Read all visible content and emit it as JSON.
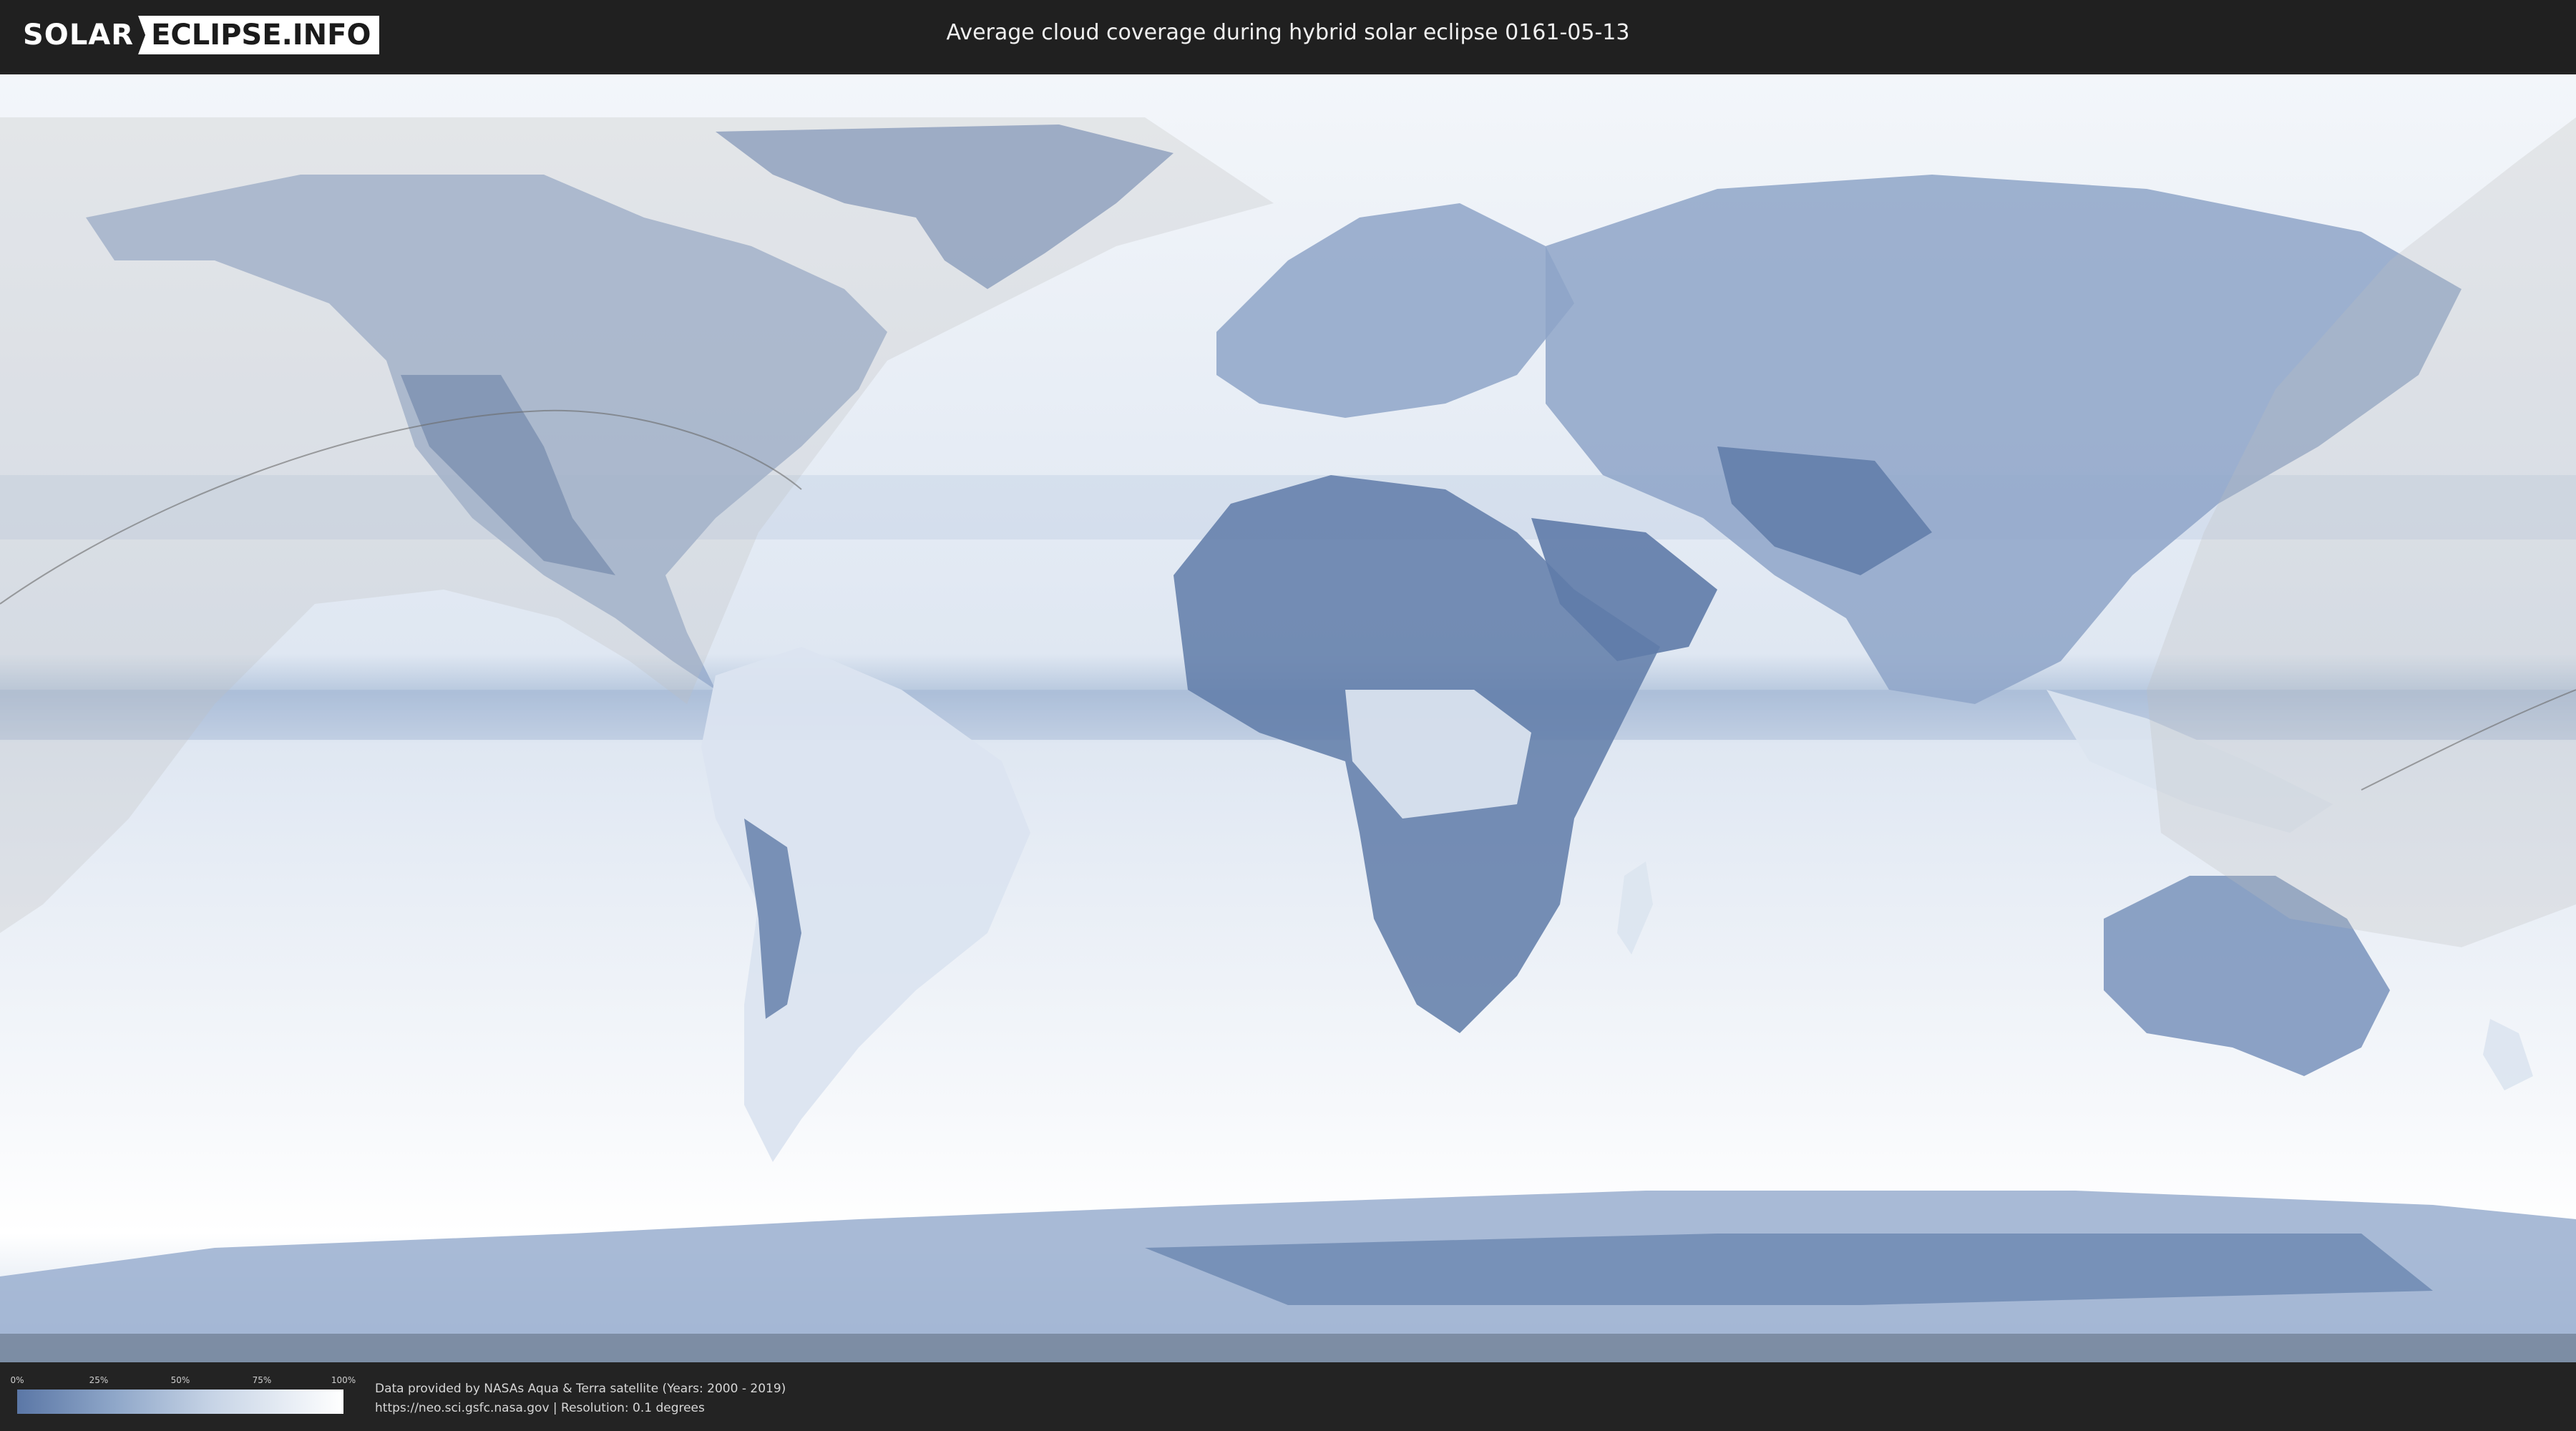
{
  "header": {
    "logo_left": "SOLAR",
    "logo_right": "ECLIPSE.INFO",
    "title": "Average cloud coverage during hybrid solar eclipse 0161-05-13"
  },
  "map": {
    "ocean_color": "#e6edf6",
    "land_cloudfree_color": "#5f7ba8",
    "shadow_color": "#bfbfbf"
  },
  "legend": {
    "ticks": [
      "0%",
      "25%",
      "50%",
      "75%",
      "100%"
    ],
    "gradient_start": "#5b77a6",
    "gradient_end": "#ffffff"
  },
  "footer": {
    "credit_line1": "Data provided by NASAs Aqua & Terra satellite (Years: 2000 - 2019)",
    "credit_line2": "https://neo.sci.gsfc.nasa.gov | Resolution: 0.1 degrees"
  }
}
